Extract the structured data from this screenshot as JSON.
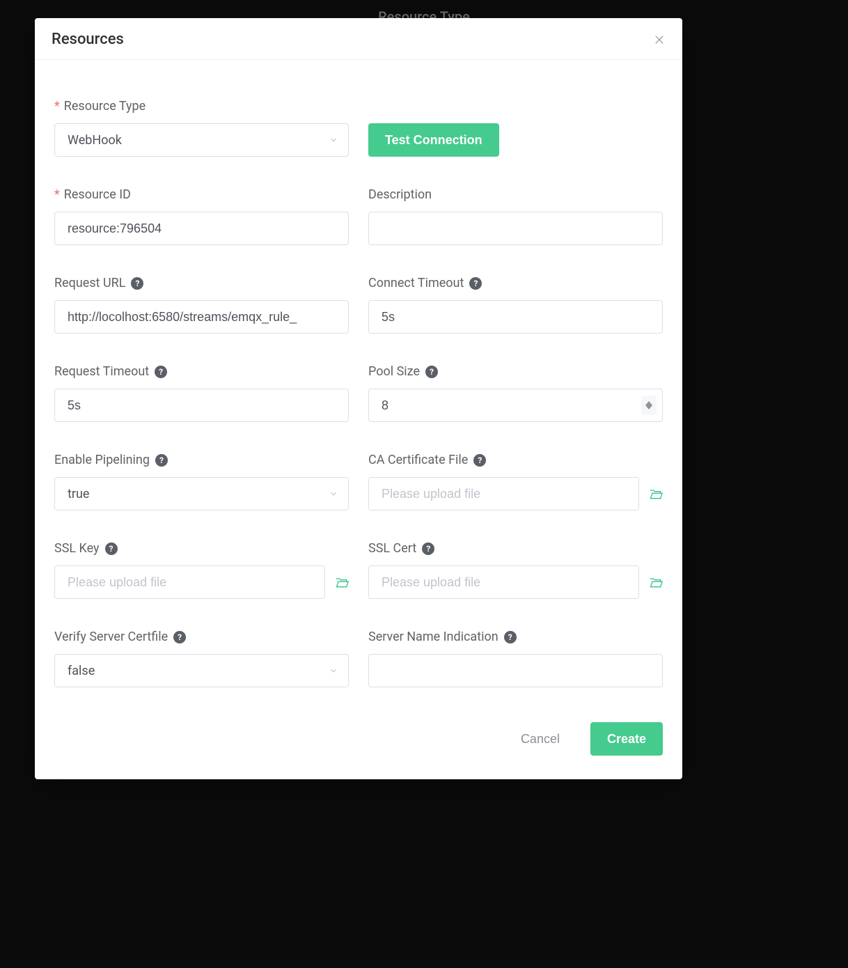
{
  "backdrop": {
    "title": "Resource Type"
  },
  "dialog": {
    "title": "Resources",
    "fields": {
      "resource_type": {
        "label": "Resource Type",
        "value": "WebHook",
        "required": true
      },
      "test_connection": {
        "label": "Test Connection"
      },
      "resource_id": {
        "label": "Resource ID",
        "value": "resource:796504",
        "required": true
      },
      "description": {
        "label": "Description",
        "value": ""
      },
      "request_url": {
        "label": "Request URL",
        "value": "http://locolhost:6580/streams/emqx_rule_"
      },
      "connect_timeout": {
        "label": "Connect Timeout",
        "value": "5s"
      },
      "request_timeout": {
        "label": "Request Timeout",
        "value": "5s"
      },
      "pool_size": {
        "label": "Pool Size",
        "value": "8"
      },
      "enable_pipelining": {
        "label": "Enable Pipelining",
        "value": "true"
      },
      "ca_cert_file": {
        "label": "CA Certificate File",
        "placeholder": "Please upload file"
      },
      "ssl_key": {
        "label": "SSL Key",
        "placeholder": "Please upload file"
      },
      "ssl_cert": {
        "label": "SSL Cert",
        "placeholder": "Please upload file"
      },
      "verify_server_certfile": {
        "label": "Verify Server Certfile",
        "value": "false"
      },
      "server_name_indication": {
        "label": "Server Name Indication",
        "value": ""
      }
    },
    "actions": {
      "cancel": "Cancel",
      "create": "Create"
    }
  }
}
